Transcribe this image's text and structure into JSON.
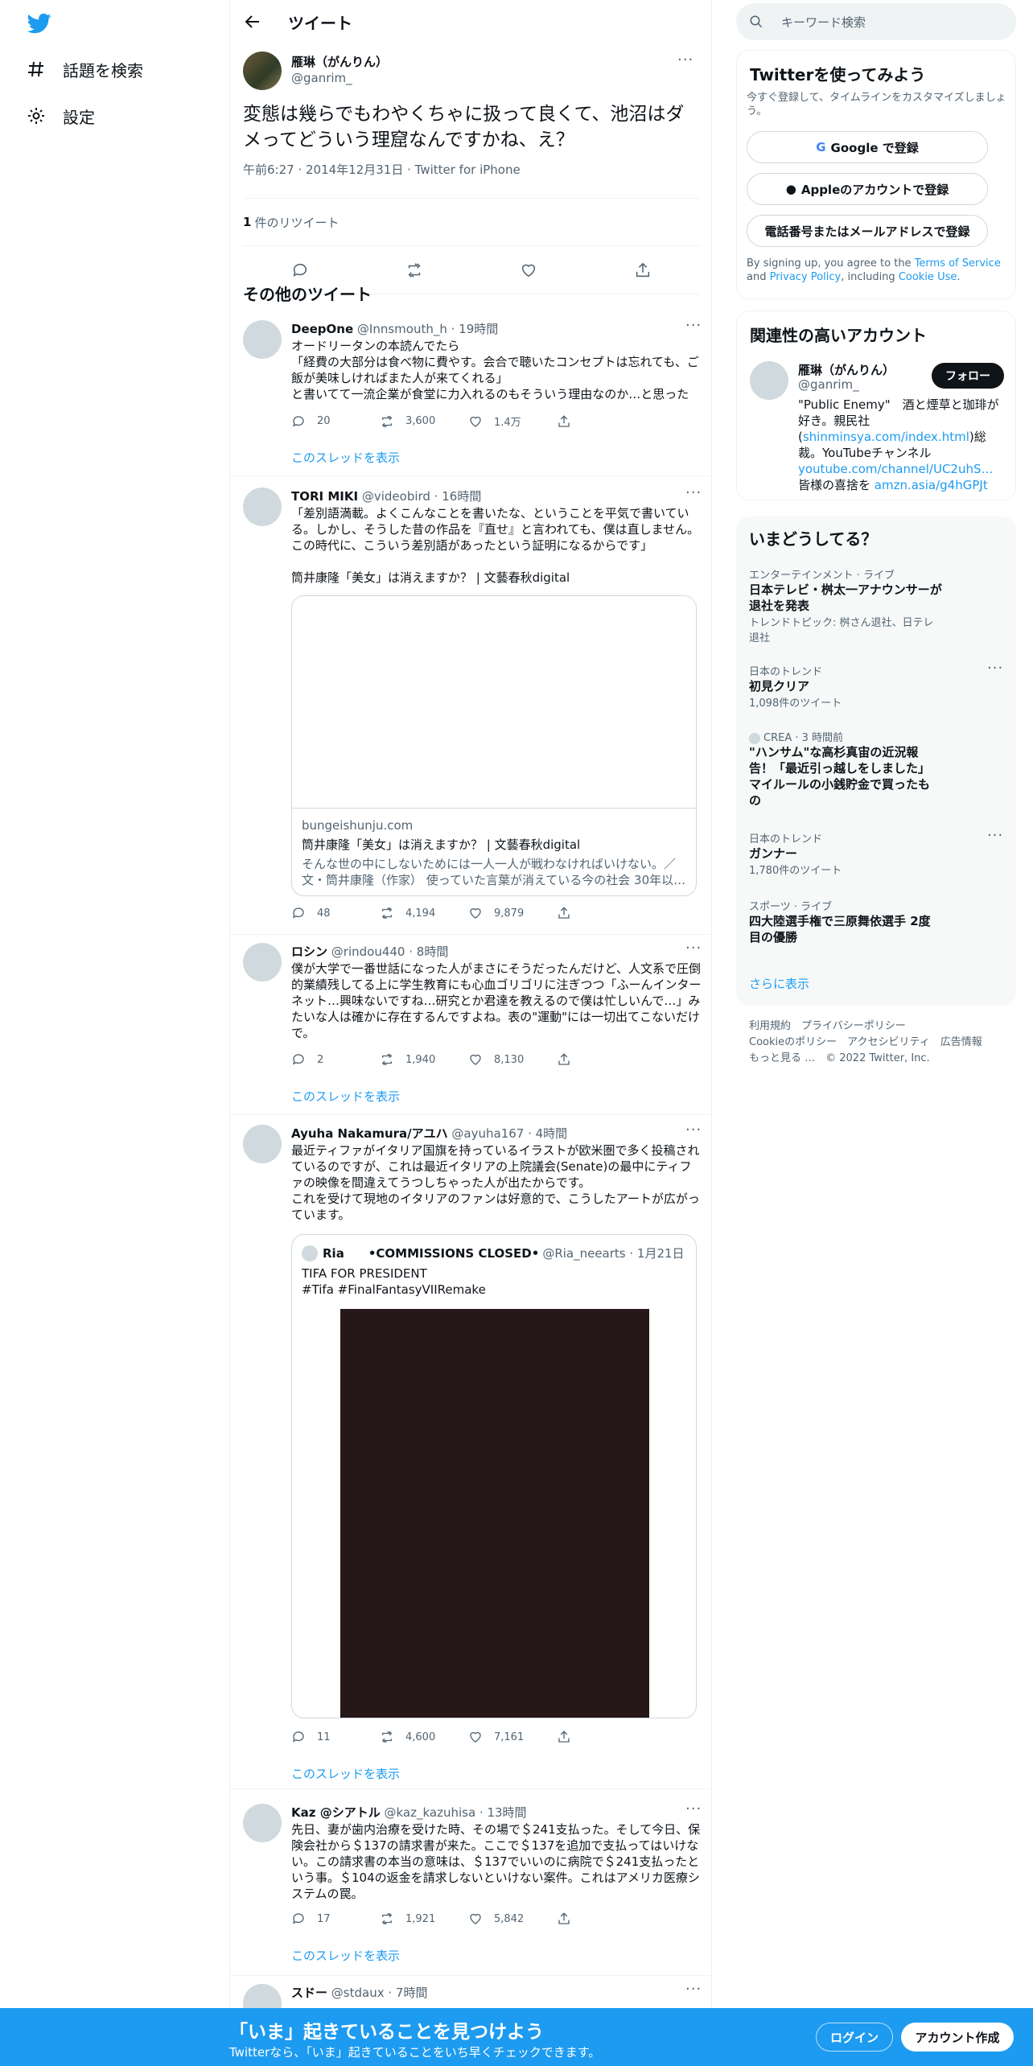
{
  "nav": {
    "explore": "話題を検索",
    "settings": "設定"
  },
  "header": {
    "title": "ツイート"
  },
  "main_tweet": {
    "name": "雁琳（がんりん）",
    "handle": "@ganrim_",
    "text": "変態は幾らでもわやくちゃに扱って良くて、池沼はダメってどういう理窟なんですかね、え？",
    "meta": "午前6:27 · 2014年12月31日 · Twitter for iPhone",
    "retweet_count": "1",
    "retweet_label": "件のリツイート"
  },
  "section_title": "その他のツイート",
  "tweets": [
    {
      "name": "DeepOne",
      "handle": "@Innsmouth_h · 19時間",
      "text": "オードリータンの本読んでたら\n「経費の大部分は食べ物に費やす。会合で聴いたコンセプトは忘れても、ご飯が美味しければまた人が来てくれる」\nと書いてて一流企業が食堂に力入れるのもそういう理由なのか…と思った",
      "replies": "20",
      "retweets": "3,600",
      "likes": "1.4万",
      "thread": "このスレッドを表示"
    },
    {
      "name": "TORI MIKI",
      "handle": "@videobird · 16時間",
      "text": "「差別語満載。よくこんなことを書いたな、ということを平気で書いている。しかし、そうした昔の作品を『直せ』と言われても、僕は直しません。この時代に、こういう差別語があったという証明になるからです」\n\n筒井康隆「美女」は消えますか？ | 文藝春秋digital",
      "card_domain": "bungeishunju.com",
      "card_title": "筒井康隆「美女」は消えますか？ | 文藝春秋digital",
      "card_desc": "そんな世の中にしないためには一人一人が戦わなければいけない。／文・筒井康隆（作家） 使っていた言葉が消えている今の社会 30年以…",
      "replies": "48",
      "retweets": "4,194",
      "likes": "9,879"
    },
    {
      "name": "ロシン",
      "handle": "@rindou440 · 8時間",
      "text": "僕が大学で一番世話になった人がまさにそうだったんだけど、人文系で圧倒的業績残してる上に学生教育にも心血ゴリゴリに注ぎつつ「ふーんインターネット…興味ないですね…研究とか君達を教えるので僕は忙しいんで…」みたいな人は確かに存在するんですよね。表の\"運動\"には一切出てこないだけで。",
      "replies": "2",
      "retweets": "1,940",
      "likes": "8,130",
      "thread": "このスレッドを表示"
    },
    {
      "name": "Ayuha Nakamura/アユハ",
      "handle": "@ayuha167 · 4時間",
      "text": "最近ティファがイタリア国旗を持っているイラストが欧米圏で多く投稿されているのですが、これは最近イタリアの上院議会(Senate)の最中にティファの映像を間違えてうつしちゃった人が出たからです。\nこれを受けて現地のイタリアのファンは好意的で、こうしたアートが広がっています。",
      "quote_name": "Ria　　•COMMISSIONS CLOSED•",
      "quote_handle": "@Ria_neearts · 1月21日",
      "quote_text": "TIFA FOR PRESIDENT\n#Tifa #FinalFantasyVIIRemake",
      "replies": "11",
      "retweets": "4,600",
      "likes": "7,161",
      "thread": "このスレッドを表示"
    },
    {
      "name": "Kaz @シアトル",
      "handle": "@kaz_kazuhisa · 13時間",
      "text": "先日、妻が歯内治療を受けた時、その場で＄241支払った。そして今日、保険会社から＄137の請求書が来た。ここで＄137を追加で支払ってはいけない。この請求書の本当の意味は、＄137でいいのに病院で＄241支払ったという事。＄104の返金を請求しないといけない案件。これはアメリカ医療システムの罠。",
      "replies": "17",
      "retweets": "1,921",
      "likes": "5,842",
      "thread": "このスレッドを表示"
    },
    {
      "name": "スドー",
      "handle": "@stdaux · 7時間"
    }
  ],
  "right": {
    "search_placeholder": "キーワード検索",
    "signup": {
      "title": "Twitterを使ってみよう",
      "desc": "今すぐ登録して、タイムラインをカスタマイズしましょう。",
      "google": "Google で登録",
      "apple": "Appleのアカウントで登録",
      "phone": "電話番号またはメールアドレスで登録",
      "terms_pre": "By signing up, you agree to the ",
      "terms": "Terms of Service",
      "and": " and ",
      "privacy": "Privacy Policy",
      "including": ", including ",
      "cookie": "Cookie Use",
      "dot": "."
    },
    "related": {
      "title": "関連性の高いアカウント",
      "name": "雁琳（がんりん）",
      "handle": "@ganrim_",
      "follow": "フォロー",
      "bio_1": "\"Public Enemy\"　酒と煙草と珈琲が好き。親民社(",
      "bio_link1": "shinminsya.com/index.html",
      "bio_2": ")総裁。YouTubeチャンネル",
      "bio_link2": "youtube.com/channel/UC2uhS…",
      "bio_3": " 皆様の喜捨を ",
      "bio_link3": "amzn.asia/g4hGPJt"
    },
    "trends": {
      "title": "いまどうしてる？",
      "items": [
        {
          "ctx": "エンターテインメント · ライブ",
          "title": "日本テレビ・桝太一アナウンサーが退社を発表",
          "sub": "トレンドトピック: 桝さん退社、日テレ退社"
        },
        {
          "ctx": "日本のトレンド",
          "title": "初見クリア",
          "sub": "1,098件のツイート"
        },
        {
          "ctx": "CREA · 3 時間前",
          "title": "\"ハンサム\"な高杉真宙の近況報告！「最近引っ越しをしました」マイルールの小銭貯金で買ったもの",
          "sub": ""
        },
        {
          "ctx": "日本のトレンド",
          "title": "ガンナー",
          "sub": "1,780件のツイート"
        },
        {
          "ctx": "スポーツ · ライブ",
          "title": "四大陸選手権で三原舞依選手 2度目の優勝",
          "sub": ""
        }
      ],
      "more": "さらに表示"
    },
    "footer": {
      "l1": "利用規約　プライバシーポリシー",
      "l2": "Cookieのポリシー　アクセシビリティ　広告情報",
      "l3": "もっと見る …　© 2022 Twitter, Inc."
    }
  },
  "bottom_bar": {
    "headline": "「いま」起きていることを見つけよう",
    "sub": "Twitterなら、「いま」起きていることをいち早くチェックできます。",
    "login": "ログイン",
    "signup": "アカウント作成"
  },
  "colors": {
    "accent": "#1d9bf0",
    "text": "#0f1419",
    "muted": "#536471",
    "border": "#eff3f4"
  }
}
